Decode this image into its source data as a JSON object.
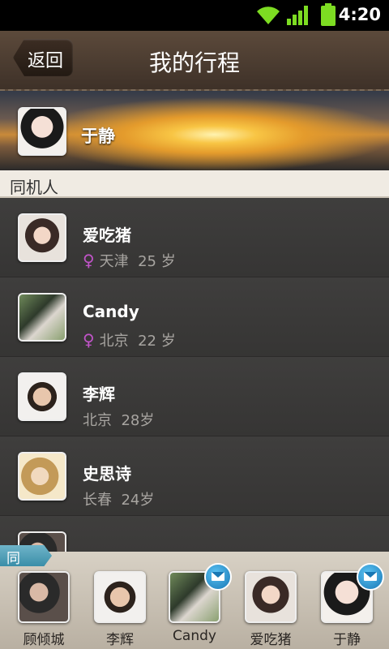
{
  "status_bar": {
    "time": "4:20",
    "icons": [
      "wifi-icon",
      "signal-icon",
      "battery-icon"
    ],
    "accent": "#7ddc22"
  },
  "header": {
    "back_label": "返回",
    "title": "我的行程"
  },
  "owner": {
    "name": "于静"
  },
  "section": {
    "label": "同机人"
  },
  "people": [
    {
      "name": "爱吃猪",
      "gender": "♀",
      "city": "天津",
      "age": "25 岁"
    },
    {
      "name": "Candy",
      "gender": "♀",
      "city": "北京",
      "age": "22 岁"
    },
    {
      "name": "李辉",
      "gender": "",
      "city": "北京",
      "age": "28岁"
    },
    {
      "name": "史思诗",
      "gender": "",
      "city": "长春",
      "age": "24岁"
    },
    {
      "name": "",
      "gender": "",
      "city": "",
      "age": ""
    }
  ],
  "companions": {
    "label": "同 伴",
    "items": [
      {
        "name": "顾倾城",
        "has_message": false
      },
      {
        "name": "李辉",
        "has_message": false
      },
      {
        "name": "Candy",
        "has_message": true
      },
      {
        "name": "爱吃猪",
        "has_message": false
      },
      {
        "name": "于静",
        "has_message": true
      }
    ]
  },
  "colors": {
    "header_bg": "#4d3d31",
    "female_icon": "#c054c8",
    "message_badge": "#1f8fd0"
  }
}
